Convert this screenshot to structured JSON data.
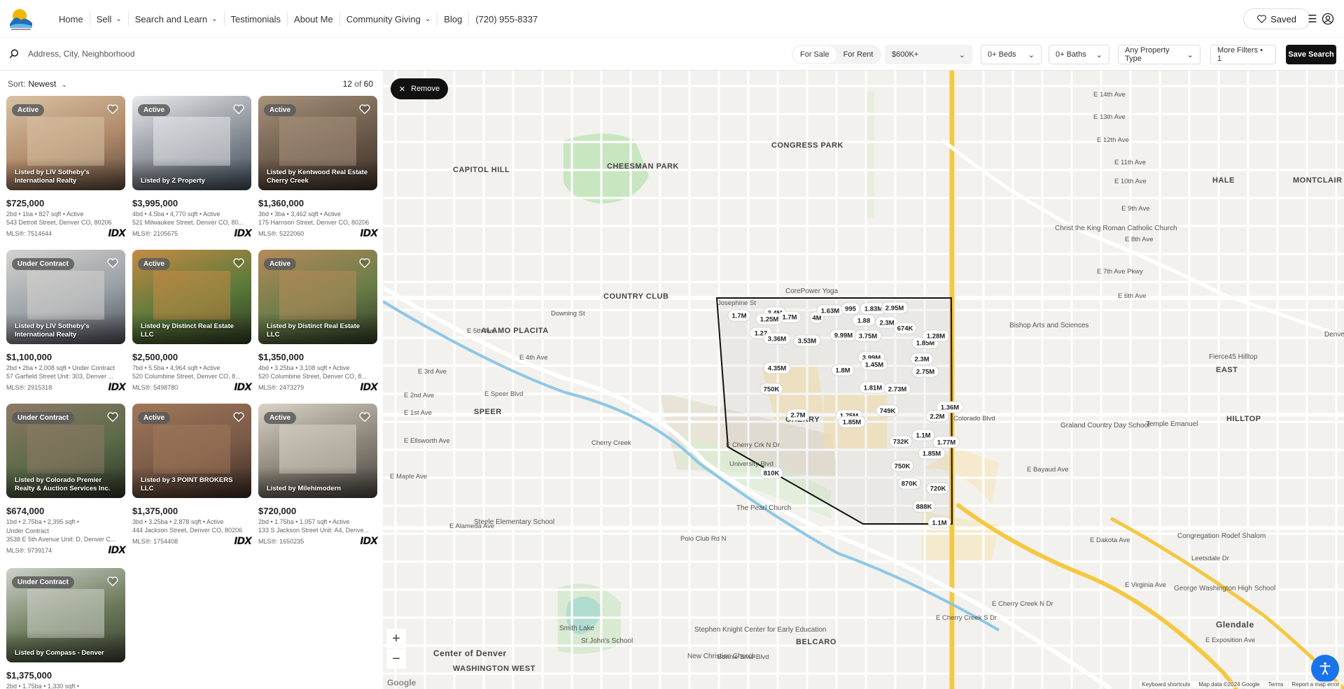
{
  "nav": {
    "items": [
      {
        "label": "Home"
      },
      {
        "label": "Sell"
      },
      {
        "label": "Search and Learn"
      },
      {
        "label": "Testimonials"
      },
      {
        "label": "About Me"
      },
      {
        "label": "Community Giving"
      },
      {
        "label": "Blog"
      },
      {
        "label": "(720) 955-8337"
      }
    ],
    "saved_label": "Saved"
  },
  "search": {
    "placeholder": "Address, City, Neighborhood",
    "for_sale": "For Sale",
    "for_rent": "For Rent",
    "price": "$600K+",
    "beds": "0+ Beds",
    "baths": "0+ Baths",
    "type": "Any Property Type",
    "more": "More Filters • 1",
    "save": "Save Search"
  },
  "list": {
    "sort_label": "Sort:",
    "sort_value": "Newest",
    "count_current": "12",
    "count_of": "of",
    "count_total": "60",
    "listings": [
      {
        "status": "Active",
        "byline": "Listed by LIV Sotheby's International Realty",
        "price": "$725,000",
        "meta": "2bd • 1ba • 827 sqft • Active",
        "addr": "543 Detroit Street, Denver CO, 80206",
        "mls": "MLS®: 7514644"
      },
      {
        "status": "Active",
        "byline": "Listed by Z Property",
        "price": "$3,995,000",
        "meta": "4bd • 4.5ba • 4,770 sqft • Active",
        "addr": "521 Milwaukee Street, Denver CO, 80...",
        "mls": "MLS®: 2105675"
      },
      {
        "status": "Active",
        "byline": "Listed by Kentwood Real Estate Cherry Creek",
        "price": "$1,360,000",
        "meta": "3bd • 3ba • 3,462 sqft • Active",
        "addr": "175 Harrison Street, Denver CO, 80206",
        "mls": "MLS®: 5222060"
      },
      {
        "status": "Under Contract",
        "byline": "Listed by LIV Sotheby's International Realty",
        "price": "$1,100,000",
        "meta": "2bd • 2ba • 2,008 sqft • Under Contract",
        "addr": "57 Garfield Street Unit: 303, Denver ...",
        "mls": "MLS®: 2915318"
      },
      {
        "status": "Active",
        "byline": "Listed by Distinct Real Estate LLC",
        "price": "$2,500,000",
        "meta": "7bd • 5.5ba • 4,964 sqft • Active",
        "addr": "520 Columbine Street, Denver CO, 8...",
        "mls": "MLS®: 5498780"
      },
      {
        "status": "Active",
        "byline": "Listed by Distinct Real Estate LLC",
        "price": "$1,350,000",
        "meta": "4bd • 3.25ba • 3,108 sqft • Active",
        "addr": "520 Columbine Street, Denver CO, 8...",
        "mls": "MLS®: 2473279"
      },
      {
        "status": "Under Contract",
        "byline": "Listed by Colorado Premier Realty & Auction Services Inc.",
        "price": "$674,000",
        "meta": "1bd • 2.75ba • 2,395 sqft •",
        "meta2": "Under Contract",
        "addr": "3538 E 5th Avenue Unit: D, Denver C...",
        "mls": "MLS®: 9739174"
      },
      {
        "status": "Active",
        "byline": "Listed by 3 POINT BROKERS LLC",
        "price": "$1,375,000",
        "meta": "3bd • 3.25ba • 2,878 sqft • Active",
        "addr": "444 Jackson Street, Denver CO, 80206",
        "mls": "MLS®: 1754408"
      },
      {
        "status": "Active",
        "byline": "Listed by Milehimodern",
        "price": "$720,000",
        "meta": "2bd • 1.75ba • 1,057 sqft • Active",
        "addr": "133 S Jackson Street Unit: A4, Denve...",
        "mls": "MLS®: 1650235"
      },
      {
        "status": "Under Contract",
        "byline": "Listed by Compass - Denver",
        "price": "$1,375,000",
        "meta": "2bd • 1.75ba • 1,330 sqft •",
        "addr": "",
        "mls": ""
      }
    ],
    "idx_label": "IDX"
  },
  "map": {
    "remove_label": "Remove",
    "zoom_in": "+",
    "zoom_out": "−",
    "neighborhoods": [
      "CONGRESS PARK",
      "CHEESMAN PARK",
      "CAPITOL HILL",
      "HALE",
      "MONTCLAIR",
      "COUNTRY CLUB",
      "ALAMO PLACITA",
      "SPEER",
      "CHERRY",
      "EAST",
      "HILLTOP",
      "BELCARO",
      "WASHINGTON WEST",
      "Glendale",
      "Center of Denver"
    ],
    "pois": [
      "CorePower Yoga",
      "Christ the King Roman Catholic Church",
      "Bishop Arts and Sciences",
      "Denver Language School Whiteman Campus",
      "Fierce45 Hilltop",
      "Graland Country Day School",
      "Temple Emanuel",
      "The Pearl Church",
      "Steele Elementary School",
      "Congregation Rodef Shalom",
      "George Washington High School",
      "Stephen Knight Center for Early Education",
      "Smith Lake",
      "St John's School",
      "New Christian Church"
    ],
    "streets": [
      "E 14th Ave",
      "E 13th Ave",
      "E 12th Ave",
      "E 11th Ave",
      "E 10th Ave",
      "E 9th Ave",
      "E 8th Ave",
      "E 7th Ave Pkwy",
      "E 6th Ave",
      "E 5th Ave",
      "E 4th Ave",
      "E 3rd Ave",
      "E 2nd Ave",
      "E 1st Ave",
      "E Ellsworth Ave",
      "E Bayaud Ave",
      "E Maple Ave",
      "E Alameda Ave",
      "E Dakota Ave",
      "E Virginia Ave",
      "E Exposition Ave",
      "E Cherry Creek N Dr",
      "E Cherry Creek S Dr",
      "E Speer Blvd",
      "Colorado Blvd",
      "University Blvd",
      "Leetsdale Dr",
      "Josephine St",
      "Downing St",
      "Cherry Creek",
      "E Cherry Crk N Dr",
      "Polo Club Rd N",
      "Bonnie Brae Blvd"
    ],
    "price_pins": [
      "1.7M",
      "3.4M",
      "1.25M",
      "1.7M",
      "4M",
      "1.63M",
      "995",
      "1.83M",
      "2.95M",
      "1.88",
      "2.3M",
      "674K",
      "1.27",
      "3.36M",
      "3.53M",
      "9.99M",
      "3.75M",
      "1.85M",
      "1.28M",
      "4.35M",
      "3.99M",
      "1.45M",
      "1.8M",
      "2.3M",
      "2.75M",
      "750K",
      "1.81M",
      "2.73M",
      "2.7M",
      "1.75M",
      "1.85M",
      "749K",
      "1.36M",
      "2.2M",
      "1.1M",
      "1.77M",
      "732K",
      "1.85M",
      "810K",
      "750K",
      "870K",
      "720K",
      "888K",
      "1.1M"
    ],
    "attribution": [
      "Keyboard shortcuts",
      "Map data ©2024 Google",
      "Terms",
      "Report a map error"
    ],
    "google": "Google"
  }
}
